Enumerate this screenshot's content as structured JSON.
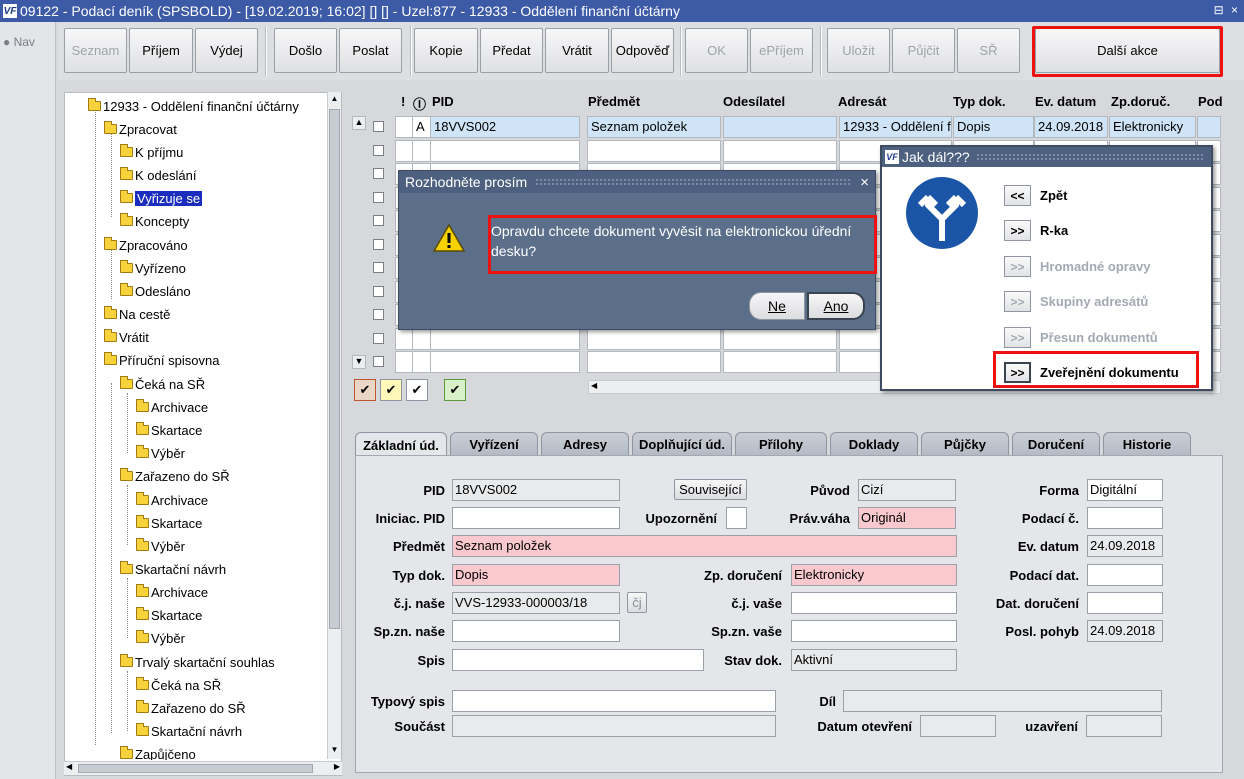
{
  "window": {
    "title": "09122 - Podací deník (SPSBOLD) - [19.02.2019; 16:02]  [] [] - Uzel:877 - 12933 - Oddělení finanční účtárny",
    "logo": "VF",
    "controls": "⊟ ×"
  },
  "nav": {
    "label": "Nav"
  },
  "toolbar": {
    "seznam": "Seznam",
    "prijem": "Příjem",
    "vydej": "Výdej",
    "doslo": "Došlo",
    "poslat": "Poslat",
    "kopie": "Kopie",
    "predat": "Předat",
    "vratit": "Vrátit",
    "odpoved": "Odpověď",
    "ok": "OK",
    "eprijem": "ePříjem",
    "ulozit": "Uložit",
    "pujcit": "Půjčit",
    "sr": "SŘ",
    "dalsi": "Další akce"
  },
  "tree": {
    "items": [
      "12933 - Oddělení finanční účtárny",
      "Zpracovat",
      "K příjmu",
      "K odeslání",
      "Vyřizuje se",
      "Koncepty",
      "Zpracováno",
      "Vyřízeno",
      "Odesláno",
      "Na cestě",
      "Vrátit",
      "Příruční spisovna",
      "Čeká na SŘ",
      "Archivace",
      "Skartace",
      "Výběr",
      "Zařazeno do SŘ",
      "Archivace",
      "Skartace",
      "Výběr",
      "Skartační návrh",
      "Archivace",
      "Skartace",
      "Výběr",
      "Trvalý skartační souhlas",
      "Čeká na SŘ",
      "Zařazeno do SŘ",
      "Skartační návrh",
      "Zapůjčeno"
    ]
  },
  "grid": {
    "headers": {
      "excl": "!",
      "clip": "Ⓘ",
      "pid": "PID",
      "predmet": "Předmět",
      "odesilatel": "Odesílatel",
      "adresat": "Adresát",
      "typ": "Typ dok.",
      "evdatum": "Ev. datum",
      "zpdoruc": "Zp.doruč.",
      "pod": "Pod"
    },
    "row1": {
      "flag": "A",
      "pid": "18VVS002",
      "predmet": "Seznam položek",
      "odesilatel": "",
      "adresat": "12933 - Oddělení f",
      "typ": "Dopis",
      "evdatum": "24.09.2018",
      "zpdoruc": "Elektronicky"
    }
  },
  "tabs": [
    "Základní úd.",
    "Vyřízení",
    "Adresy",
    "Doplňující úd.",
    "Přílohy",
    "Doklady",
    "Půjčky",
    "Doručení",
    "Historie"
  ],
  "form": {
    "pid_l": "PID",
    "pid": "18VVS002",
    "souvisejici": "Související",
    "puvod_l": "Původ",
    "puvod": "Cizí",
    "forma_l": "Forma",
    "forma": "Digitální",
    "iniciac_l": "Iniciac. PID",
    "upozorneni_l": "Upozornění",
    "pravvaha_l": "Práv.váha",
    "pravvaha": "Originál",
    "podacic_l": "Podací č.",
    "predmet_l": "Předmět",
    "predmet": "Seznam položek",
    "evdatum_l": "Ev. datum",
    "evdatum": "24.09.2018",
    "typdok_l": "Typ dok.",
    "typdok": "Dopis",
    "zpdoruceni_l": "Zp. doručení",
    "zpdoruceni": "Elektronicky",
    "podacidat_l": "Podací dat.",
    "cjnase_l": "č.j. naše",
    "cjnase": "VVS-12933-000003/18",
    "cj_btn": "čj",
    "cjvase_l": "č.j. vaše",
    "datdoruceni_l": "Dat. doručení",
    "spznnase_l": "Sp.zn. naše",
    "spznvase_l": "Sp.zn. vaše",
    "poslpohyb_l": "Posl. pohyb",
    "poslpohyb": "24.09.2018",
    "spis_l": "Spis",
    "stavdok_l": "Stav dok.",
    "stavdok": "Aktivní",
    "typovyspis_l": "Typový spis",
    "dil_l": "Díl",
    "soucast_l": "Součást",
    "datumotevreni_l": "Datum otevření",
    "uzavreni_l": "uzavření"
  },
  "dialog": {
    "title": "Rozhodněte prosím",
    "message": "Opravdu chcete dokument vyvěsit na elektronickou úřední desku?",
    "no": "Ne",
    "yes": "Ano",
    "close": "×"
  },
  "jak": {
    "title": "Jak dál???",
    "logo": "VF",
    "items": [
      {
        "btn": "<<",
        "label": "Zpět"
      },
      {
        "btn": ">>",
        "label": "R-ka"
      },
      {
        "btn": ">>",
        "label": "Hromadné opravy"
      },
      {
        "btn": ">>",
        "label": "Skupiny adresátů"
      },
      {
        "btn": ">>",
        "label": "Přesun dokumentů"
      },
      {
        "btn": ">>",
        "label": "Zveřejnění dokumentu"
      }
    ]
  },
  "colors": {
    "titlebar": "#3c5aa6",
    "dialog": "#5c6f8a",
    "highlight": "#e11111",
    "pink": "#f9c9cd",
    "selection": "#1a2dbe"
  }
}
